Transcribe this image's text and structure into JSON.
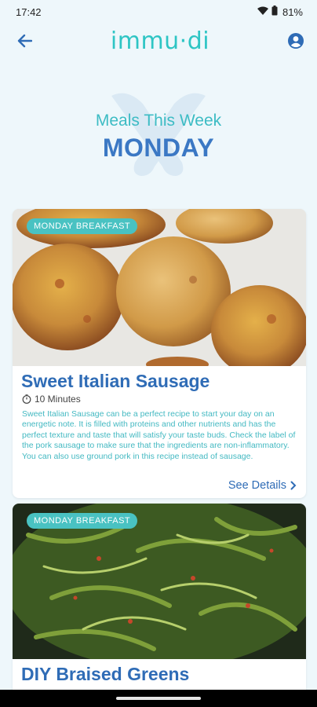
{
  "status_bar": {
    "time": "17:42",
    "battery": "81%"
  },
  "app_bar": {
    "title": "immu·di"
  },
  "hero": {
    "subtitle": "Meals This Week",
    "day": "MONDAY"
  },
  "meals": [
    {
      "badge": "MONDAY BREAKFAST",
      "title": "Sweet Italian Sausage",
      "time": "10 Minutes",
      "description": "Sweet Italian Sausage can be a perfect recipe to start your day on an energetic note. It is filled with proteins and other nutrients and has the perfect texture and taste that will satisfy your taste buds. Check the label of the pork sausage to make sure that the ingredients are non-inflammatory. You can also use ground pork in this recipe instead of sausage.",
      "link": "See Details"
    },
    {
      "badge": "MONDAY BREAKFAST",
      "title": "DIY Braised Greens"
    }
  ],
  "colors": {
    "brand": "#2ec5c4",
    "heading_blue": "#3b78c4",
    "title_blue": "#2f6cb6",
    "badge": "#49c2c2",
    "background": "#eef7fb"
  }
}
